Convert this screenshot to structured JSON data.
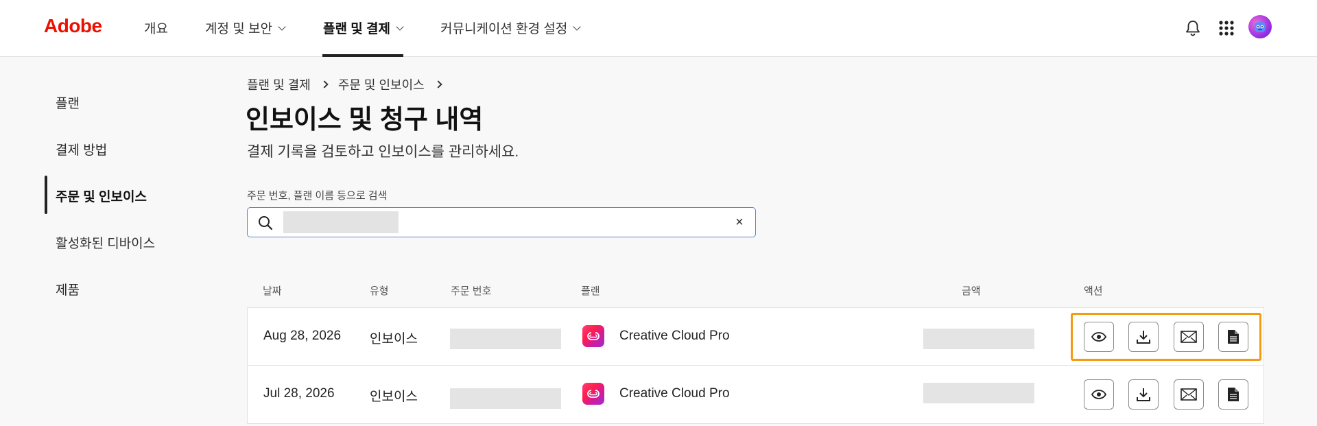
{
  "app": {
    "logo": "Adobe"
  },
  "nav": {
    "items": [
      {
        "label": "개요"
      },
      {
        "label": "계정 및 보안"
      },
      {
        "label": "플랜 및 결제"
      },
      {
        "label": "커뮤니케이션 환경 설정"
      }
    ],
    "active_index": 2
  },
  "sidebar": {
    "items": [
      {
        "label": "플랜"
      },
      {
        "label": "결제 방법"
      },
      {
        "label": "주문 및 인보이스"
      },
      {
        "label": "활성화된 디바이스"
      },
      {
        "label": "제품"
      }
    ],
    "active_index": 2
  },
  "breadcrumb": {
    "items": [
      "플랜 및 결제",
      "주문 및 인보이스"
    ]
  },
  "page": {
    "title": "인보이스 및 청구 내역",
    "subtitle": "결제 기록을 검토하고 인보이스를 관리하세요."
  },
  "search": {
    "label": "주문 번호, 플랜 이름 등으로 검색",
    "value": ""
  },
  "table": {
    "headers": {
      "date": "날짜",
      "type": "유형",
      "order": "주문 번호",
      "plan": "플랜",
      "amount": "금액",
      "actions": "액션"
    },
    "rows": [
      {
        "date": "Aug 28, 2026",
        "type": "인보이스",
        "plan": "Creative Cloud Pro"
      },
      {
        "date": "Jul 28, 2026",
        "type": "인보이스",
        "plan": "Creative Cloud Pro"
      }
    ]
  },
  "icons": {
    "notification": "bell-icon",
    "apps": "app-grid-icon",
    "search": "search-icon",
    "clear": "close-icon",
    "view": "eye-icon",
    "download": "download-icon",
    "email": "envelope-icon",
    "document": "document-icon"
  },
  "colors": {
    "brand": "#eb1000",
    "highlight": "#f39c12",
    "search_border": "#5a87c6"
  }
}
